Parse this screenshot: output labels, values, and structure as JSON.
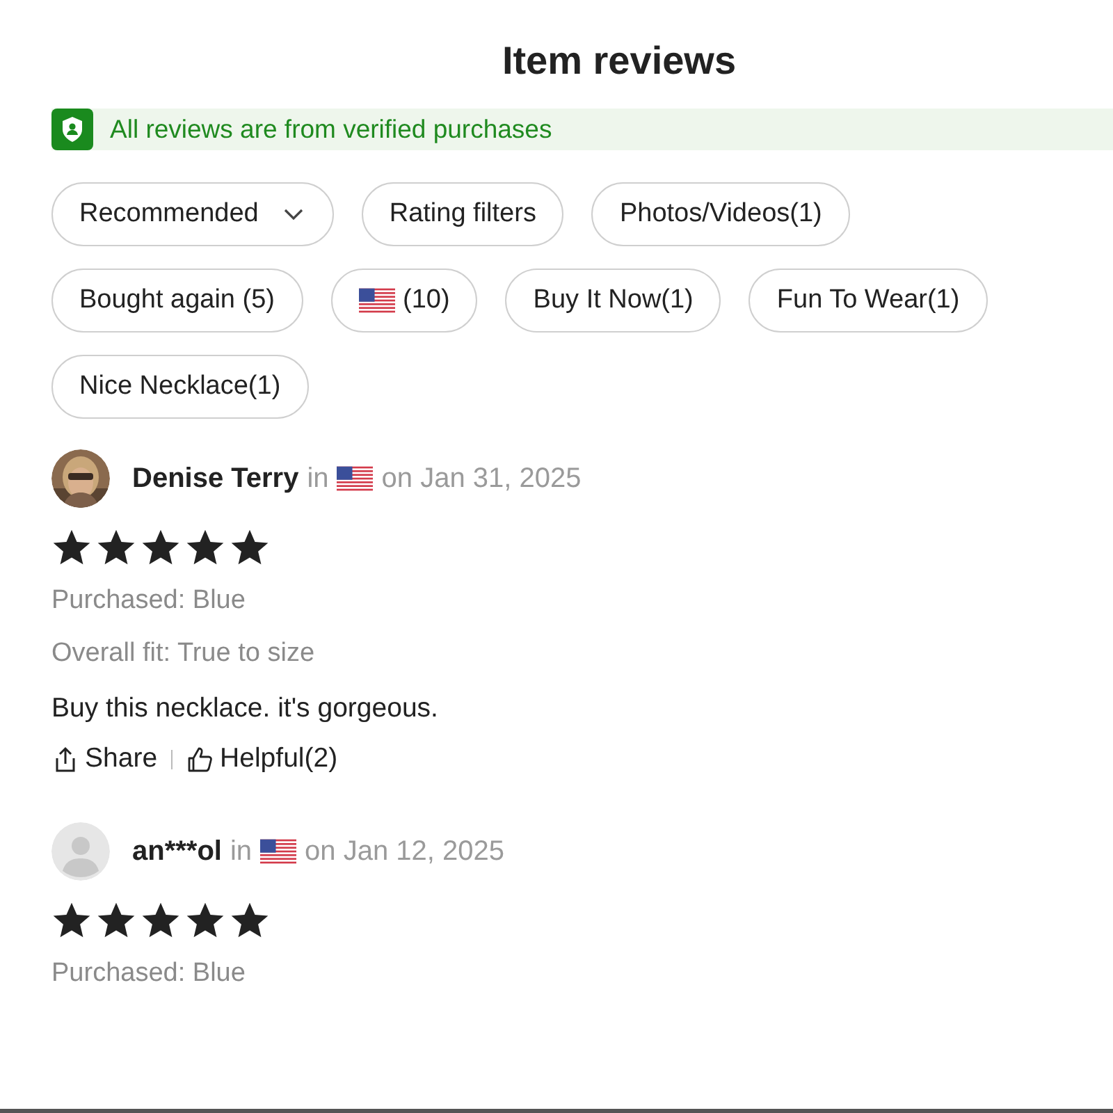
{
  "title": "Item reviews",
  "verified_banner": {
    "text": "All reviews are from verified purchases"
  },
  "filters": [
    {
      "kind": "dropdown",
      "label": "Recommended"
    },
    {
      "kind": "filter",
      "label": "Rating filters"
    },
    {
      "kind": "filter",
      "label": "Photos/Videos(1)"
    },
    {
      "kind": "filter",
      "label": "Bought again (5)"
    },
    {
      "kind": "flag",
      "label": "(10)"
    },
    {
      "kind": "filter",
      "label": "Buy It Now(1)"
    },
    {
      "kind": "filter",
      "label": "Fun To Wear(1)"
    },
    {
      "kind": "filter",
      "label": "Nice Necklace(1)"
    }
  ],
  "reviews": [
    {
      "name": "Denise Terry",
      "location_prefix": "in",
      "date": "on Jan 31, 2025",
      "stars": 5,
      "details": [
        "Purchased: Blue",
        "Overall fit: True to size"
      ],
      "text": "Buy this necklace. it's gorgeous.",
      "share": "Share",
      "helpful": "Helpful(2)"
    },
    {
      "avatar": {
        "kind": "placeholder"
      },
      "name": "an***ol",
      "location_prefix": "in",
      "date": "on Jan 12, 2025",
      "stars": 5,
      "details": [
        "Purchased: Blue"
      ]
    }
  ]
}
